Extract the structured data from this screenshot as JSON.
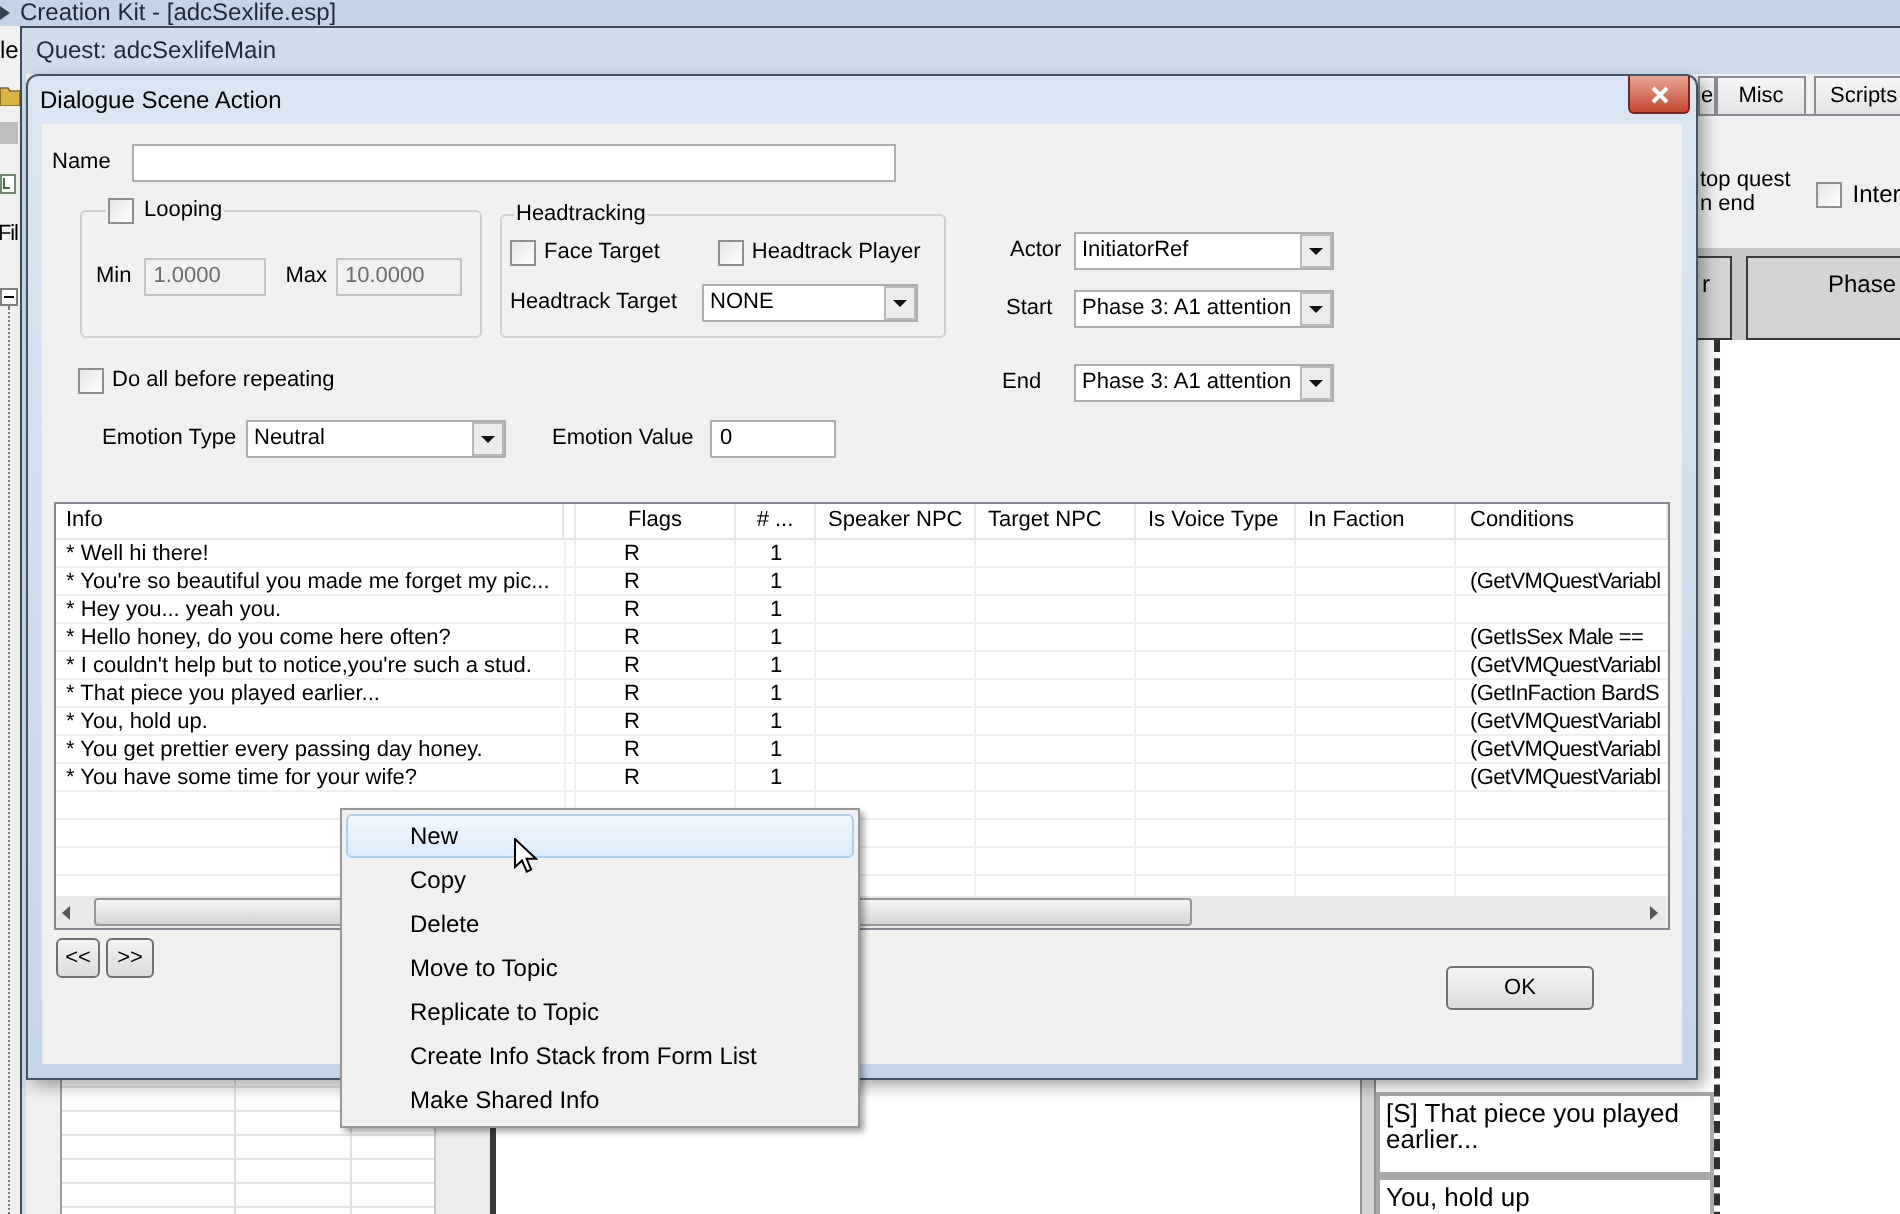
{
  "main_window": {
    "title": "Creation Kit - [adcSexlife.esp]",
    "menu_fragment": "le",
    "panel_label_fragment": "Fil"
  },
  "quest_window": {
    "title": "Quest: adcSexlifeMain",
    "tabs": [
      {
        "label": "e",
        "selected": false
      },
      {
        "label": "Misc",
        "selected": false
      },
      {
        "label": "Scripts",
        "selected": false
      }
    ],
    "stop_option_label": "top quest\nn end",
    "inter_option": {
      "label": "Inter",
      "checked": false
    },
    "scene_headers": [
      "r",
      "Phase"
    ],
    "actions": [
      "[S] That piece you played earlier...",
      "You, hold up"
    ]
  },
  "dialog": {
    "title": "Dialogue Scene Action",
    "name_field": {
      "label": "Name"
    },
    "looping": {
      "label": "Looping",
      "checked": false,
      "min": {
        "label": "Min",
        "value": "1.0000",
        "disabled": true
      },
      "max": {
        "label": "Max",
        "value": "10.0000",
        "disabled": true
      }
    },
    "headtracking": {
      "title": "Headtracking",
      "face_target": {
        "label": "Face Target",
        "checked": false
      },
      "headtrack_player": {
        "label": "Headtrack Player",
        "checked": false
      },
      "headtrack_target": {
        "label": "Headtrack Target",
        "value": "NONE"
      }
    },
    "actor": {
      "label": "Actor",
      "value": "InitiatorRef"
    },
    "start": {
      "label": "Start",
      "value": "Phase 3: A1 attention"
    },
    "end": {
      "label": "End",
      "value": "Phase 3: A1 attention"
    },
    "do_all_before_repeating": {
      "label": "Do all before repeating",
      "checked": false
    },
    "emotion_type": {
      "label": "Emotion Type",
      "value": "Neutral"
    },
    "emotion_value": {
      "label": "Emotion Value",
      "value": "0"
    },
    "info_table": {
      "columns": [
        "Info",
        "Flags",
        "# ...",
        "Speaker NPC",
        "Target NPC",
        "Is Voice Type",
        "In Faction",
        "Conditions"
      ],
      "rows": [
        {
          "info": "* Well hi there!",
          "flags": "R",
          "count": "1"
        },
        {
          "info": "* You're so beautiful you made me forget my pic...",
          "flags": "R",
          "count": "1",
          "conditions": "(GetVMQuestVariabl"
        },
        {
          "info": "* Hey you... yeah you.",
          "flags": "R",
          "count": "1"
        },
        {
          "info": "* Hello honey, do you come here often?",
          "flags": "R",
          "count": "1",
          "conditions": "(GetIsSex Male =="
        },
        {
          "info": "* I couldn't help but to notice,you're such a stud.",
          "flags": "R",
          "count": "1",
          "conditions": "(GetVMQuestVariabl"
        },
        {
          "info": "* That piece you played earlier...",
          "flags": "R",
          "count": "1",
          "conditions": "(GetInFaction BardS"
        },
        {
          "info": "* You, hold up.",
          "flags": "R",
          "count": "1",
          "conditions": "(GetVMQuestVariabl"
        },
        {
          "info": "* You get prettier every passing day honey.",
          "flags": "R",
          "count": "1",
          "conditions": "(GetVMQuestVariabl"
        },
        {
          "info": "* You have some time for your wife?",
          "flags": "R",
          "count": "1",
          "conditions": "(GetVMQuestVariabl"
        }
      ]
    },
    "nav_buttons": [
      "<<",
      ">>"
    ],
    "ok_button": "OK"
  },
  "context_menu": {
    "items": [
      {
        "label": "New",
        "selected": true
      },
      {
        "label": "Copy",
        "selected": false
      },
      {
        "label": "Delete",
        "selected": false
      },
      {
        "label": "Move to Topic",
        "selected": false
      },
      {
        "label": "Replicate to Topic",
        "selected": false
      },
      {
        "label": "Create Info Stack from Form List",
        "selected": false
      },
      {
        "label": "Make Shared Info",
        "selected": false
      }
    ]
  }
}
